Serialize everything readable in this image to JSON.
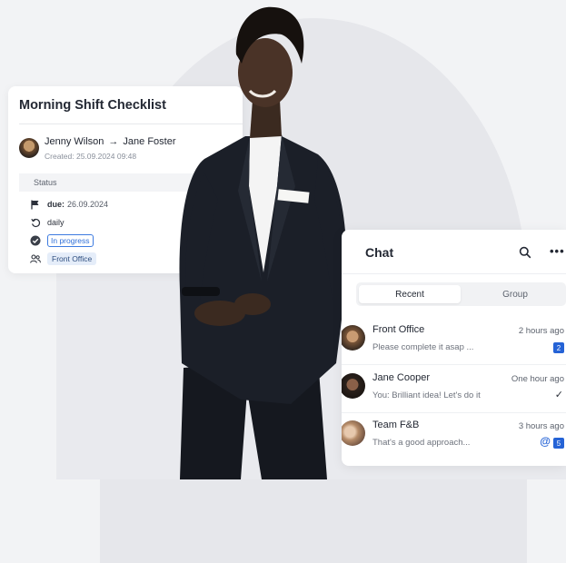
{
  "checklist": {
    "title": "Morning Shift Checklist",
    "from_user": "Jenny Wilson",
    "arrow": "→",
    "to_user": "Jane Foster",
    "created": "Created: 25.09.2024 09:48",
    "status_label": "Status",
    "due_key": "due:",
    "due_value": "26.09.2024",
    "recurrence": "daily",
    "progress": "In progress",
    "department": "Front Office"
  },
  "chat": {
    "title": "Chat",
    "more": "•••",
    "tabs": [
      {
        "label": "Recent",
        "active": true
      },
      {
        "label": "Group",
        "active": false
      }
    ],
    "messages": [
      {
        "name": "Front Office",
        "time": "2 hours ago",
        "preview": "Please complete it asap ...",
        "badge": "2"
      },
      {
        "name": "Jane Cooper",
        "time": "One hour ago",
        "preview": "You: Brilliant idea! Let's do it",
        "status": "✓"
      },
      {
        "name": "Team F&B",
        "time": "3 hours ago",
        "preview": "That's a good approach...",
        "mention": "@",
        "badge": "5"
      }
    ]
  },
  "icons": [
    "flag-icon",
    "repeat-icon",
    "check-circle-icon",
    "people-icon",
    "search-icon",
    "more-icon"
  ],
  "colors": {
    "accent": "#2563d6",
    "background": "#f2f3f5",
    "card": "#ffffff"
  }
}
